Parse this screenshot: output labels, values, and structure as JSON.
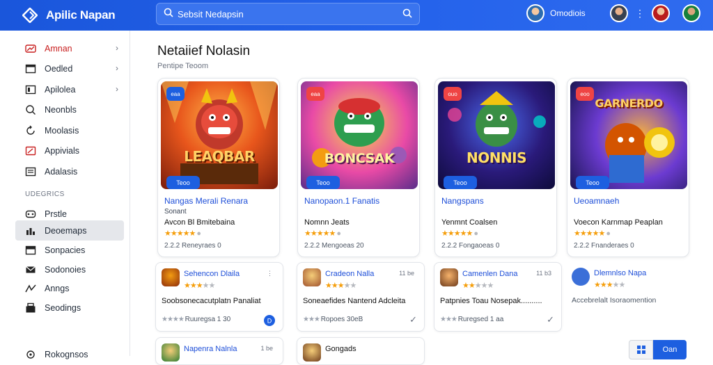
{
  "app": {
    "title": "Apilic Napan"
  },
  "search": {
    "value": "Sebsit Nedapsin"
  },
  "user": {
    "label": "Omodiois"
  },
  "sidebar": {
    "items": [
      {
        "label": "Amnan",
        "icon": "trend-icon",
        "chevron": true
      },
      {
        "label": "Oedled",
        "icon": "window-icon",
        "chevron": true
      },
      {
        "label": "Apilolea",
        "icon": "grid-icon",
        "chevron": true
      },
      {
        "label": "Neonbls",
        "icon": "search-icon",
        "chevron": false
      },
      {
        "label": "Moolasis",
        "icon": "refresh-icon",
        "chevron": false
      },
      {
        "label": "Appivials",
        "icon": "tag-icon",
        "chevron": false
      },
      {
        "label": "Adalasis",
        "icon": "list-icon",
        "chevron": false
      }
    ],
    "section_label": "UDEGRICS",
    "section_items": [
      {
        "label": "Prstle",
        "icon": "device-icon"
      },
      {
        "label": "Deoemaps",
        "icon": "chart-icon"
      },
      {
        "label": "Sonpacies",
        "icon": "box-icon"
      },
      {
        "label": "Sodonoies",
        "icon": "mail-icon"
      },
      {
        "label": "Anngs",
        "icon": "bird-icon"
      },
      {
        "label": "Seodings",
        "icon": "store-icon"
      }
    ],
    "footer_label": "Rokognsos"
  },
  "main": {
    "title": "Netaiief Nolasin",
    "subtitle": "Pentipe Teoom"
  },
  "cards": [
    {
      "art_title": "LEAQBAR",
      "badge": "eaa",
      "tag": "Teoo",
      "title": "Nangas Merali Renara",
      "category": "Sonant",
      "developer": "Avcon Bl Bmitebaina",
      "stars": 5,
      "meta": "2.2.2 Reneyraes 0",
      "accent": "#1d5fe0"
    },
    {
      "art_title": "BONCSAK",
      "badge": "eaa",
      "tag": "Teoo",
      "title": "Nanopaon.1 Fanatis",
      "category": "",
      "developer": "Nomnn Jeats",
      "stars": 5,
      "meta": "2.2.2 Mengoeas 20",
      "accent": "#ef4444"
    },
    {
      "art_title": "NONNIS",
      "badge": "ouo",
      "tag": "Teoo",
      "title": "Nangspans",
      "category": "",
      "developer": "Yenmnt Coalsen",
      "stars": 5,
      "meta": "2.2.2 Fongaoeas 0",
      "accent": "#ef4444"
    },
    {
      "art_title": "GARNERDO",
      "badge": "eoo",
      "tag": "Teoo",
      "title": "Ueoamnaeh",
      "category": "",
      "developer": "Voecon Karnmap Peaplan",
      "stars": 5,
      "meta": "2.2.2 Fnanderaes 0",
      "accent": "#ef4444"
    }
  ],
  "mini_cards": [
    {
      "title": "Sehencon Dlaila",
      "rank": "",
      "stars": 3,
      "desc": "Soobsonecacutplatn Panaliat",
      "footer": "Ruuregsa 1 30"
    },
    {
      "title": "Cradeon Nalla",
      "rank": "11 be",
      "stars": 3,
      "desc": "Soneaefides Nantend Adcleita",
      "footer": "Ropoes 30eB"
    },
    {
      "title": "Camenlen Dana",
      "rank": "11 b3",
      "stars": 3,
      "desc": "Patpnies Toau Nosepak..........",
      "footer": "Ruregsed 1 aa"
    },
    {
      "title": "Dlemnlso Napa",
      "rank": "",
      "stars": 3,
      "desc": "Accebrelalt Isoraomention",
      "footer": ""
    },
    {
      "title": "Napenra Nalnla",
      "rank": "1 be",
      "stars": 0,
      "desc": "",
      "footer": ""
    },
    {
      "title": "Gongads",
      "rank": "",
      "stars": 0,
      "desc": "",
      "footer": ""
    }
  ],
  "buttons": {
    "open": "Oan"
  },
  "colors": {
    "accent": "#1d5fe0",
    "star": "#f59e0b"
  }
}
